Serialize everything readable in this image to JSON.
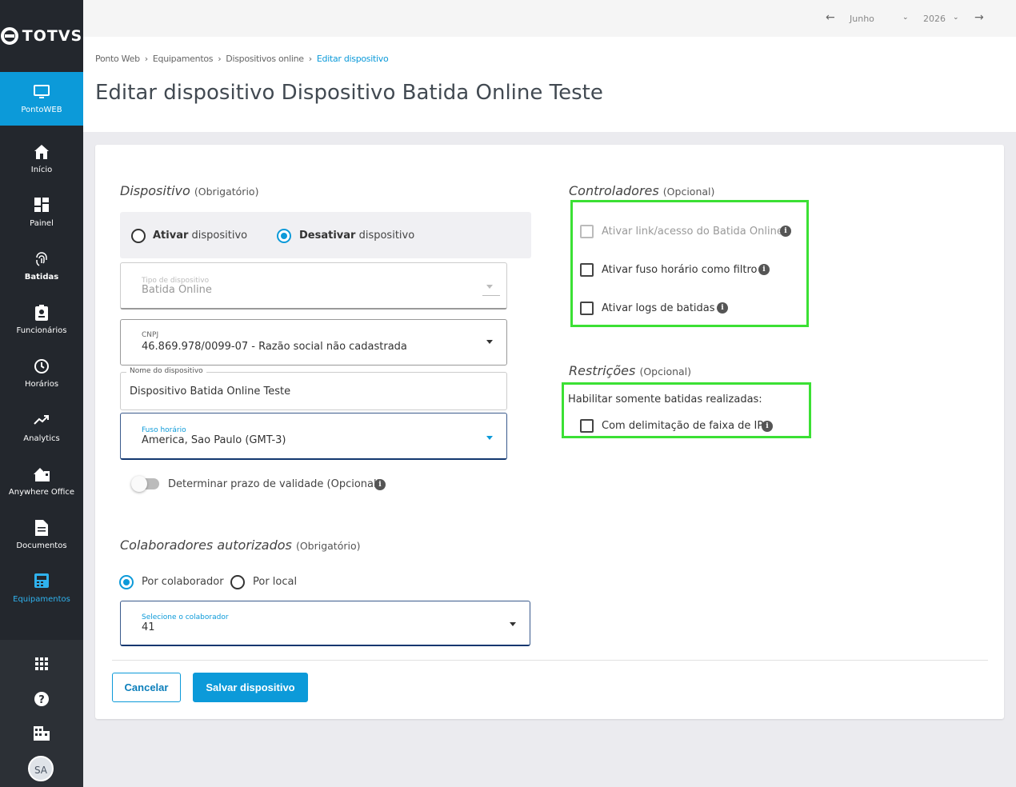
{
  "brand": {
    "logo_text": "TOTVS",
    "accent": "#0c9ad9",
    "sidebar_bg": "#23272d",
    "highlight_box": "#3be034"
  },
  "sidebar": {
    "items": [
      {
        "label": "PontoWEB",
        "icon": "monitor-icon"
      },
      {
        "label": "Início",
        "icon": "home-icon"
      },
      {
        "label": "Painel",
        "icon": "dashboard-icon"
      },
      {
        "label": "Batidas",
        "icon": "fingerprint-icon"
      },
      {
        "label": "Funcionários",
        "icon": "badge-icon"
      },
      {
        "label": "Horários",
        "icon": "clock-icon"
      },
      {
        "label": "Analytics",
        "icon": "trend-icon"
      },
      {
        "label": "Anywhere Office",
        "icon": "house-office-icon"
      },
      {
        "label": "Documentos",
        "icon": "document-icon"
      },
      {
        "label": "Equipamentos",
        "icon": "device-icon"
      }
    ],
    "bottom": {
      "apps_icon": "grid-icon",
      "help_icon": "help-icon",
      "company_icon": "building-icon",
      "avatar": "SA"
    }
  },
  "topbar": {
    "month": "Junho",
    "year": "2026"
  },
  "breadcrumb": [
    "Ponto Web",
    "Equipamentos",
    "Dispositivos online",
    "Editar dispositivo"
  ],
  "page_title": "Editar dispositivo Dispositivo Batida Online Teste",
  "device": {
    "section_title": "Dispositivo",
    "section_note": "(Obrigatório)",
    "activate": {
      "bold": "Ativar",
      "rest": " dispositivo"
    },
    "deactivate": {
      "bold": "Desativar",
      "rest": " dispositivo"
    },
    "selected": "deactivate",
    "type": {
      "label": "Tipo de dispositivo",
      "value": "Batida Online"
    },
    "cnpj": {
      "label": "CNPJ",
      "value": "46.869.978/0099-07 - Razão social não cadastrada"
    },
    "name": {
      "label": "Nome do dispositivo",
      "value": "Dispositivo Batida Online Teste"
    },
    "timezone": {
      "label": "Fuso horário",
      "value": "America, Sao Paulo (GMT-3)"
    },
    "validity_toggle": "Determinar prazo de validade (Opcional)"
  },
  "collaborators": {
    "section_title": "Colaboradores autorizados",
    "section_note": "(Obrigatório)",
    "by_collaborator": "Por colaborador",
    "by_location": "Por local",
    "select": {
      "label": "Selecione o colaborador",
      "value": "41"
    }
  },
  "controllers": {
    "section_title": "Controladores",
    "section_note": "(Opcional)",
    "items": [
      {
        "label": "Ativar link/acesso do Batida Online",
        "disabled": true,
        "checked": false
      },
      {
        "label": "Ativar fuso horário como filtro",
        "disabled": false,
        "checked": false
      },
      {
        "label": "Ativar logs de batidas",
        "disabled": false,
        "checked": false
      }
    ]
  },
  "restrictions": {
    "section_title": "Restrições",
    "section_note": "(Opcional)",
    "caption": "Habilitar somente batidas realizadas:",
    "ip_range": "Com delimitação de faixa de IP"
  },
  "actions": {
    "cancel": "Cancelar",
    "save": "Salvar dispositivo"
  }
}
